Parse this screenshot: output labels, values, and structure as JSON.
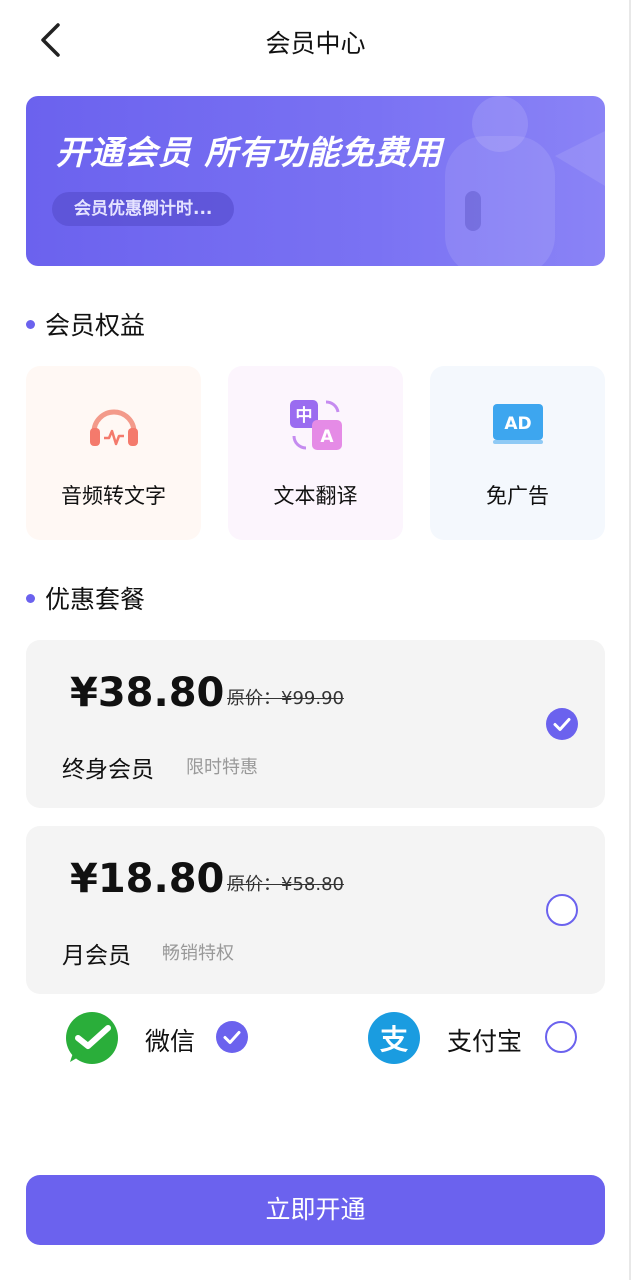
{
  "header": {
    "title": "会员中心"
  },
  "banner": {
    "title": "开通会员  所有功能免费用",
    "countdown": "会员优惠倒计时..."
  },
  "benefits_section": {
    "title": "会员权益"
  },
  "benefits": [
    {
      "label": "音频转文字",
      "icon": "headphone-icon",
      "bg": "#fff8f4"
    },
    {
      "label": "文本翻译",
      "icon": "translate-icon",
      "bg": "#fcf5fd"
    },
    {
      "label": "免广告",
      "icon": "ad-icon",
      "bg": "#f4f8fd"
    }
  ],
  "plans_section": {
    "title": "优惠套餐"
  },
  "plans": [
    {
      "price": "¥38.80",
      "original": "原价：¥99.90",
      "name": "终身会员",
      "tag": "限时特惠",
      "selected": true
    },
    {
      "price": "¥18.80",
      "original": "原价：¥58.80",
      "name": "月会员",
      "tag": "畅销特权",
      "selected": false
    }
  ],
  "payment": [
    {
      "label": "微信",
      "icon": "wechat-icon",
      "selected": true
    },
    {
      "label": "支付宝",
      "icon": "alipay-icon",
      "selected": false
    }
  ],
  "cta": {
    "label": "立即开通"
  },
  "colors": {
    "accent": "#6b62ee",
    "wechat": "#2aae3a",
    "alipay": "#1a9ce0"
  }
}
